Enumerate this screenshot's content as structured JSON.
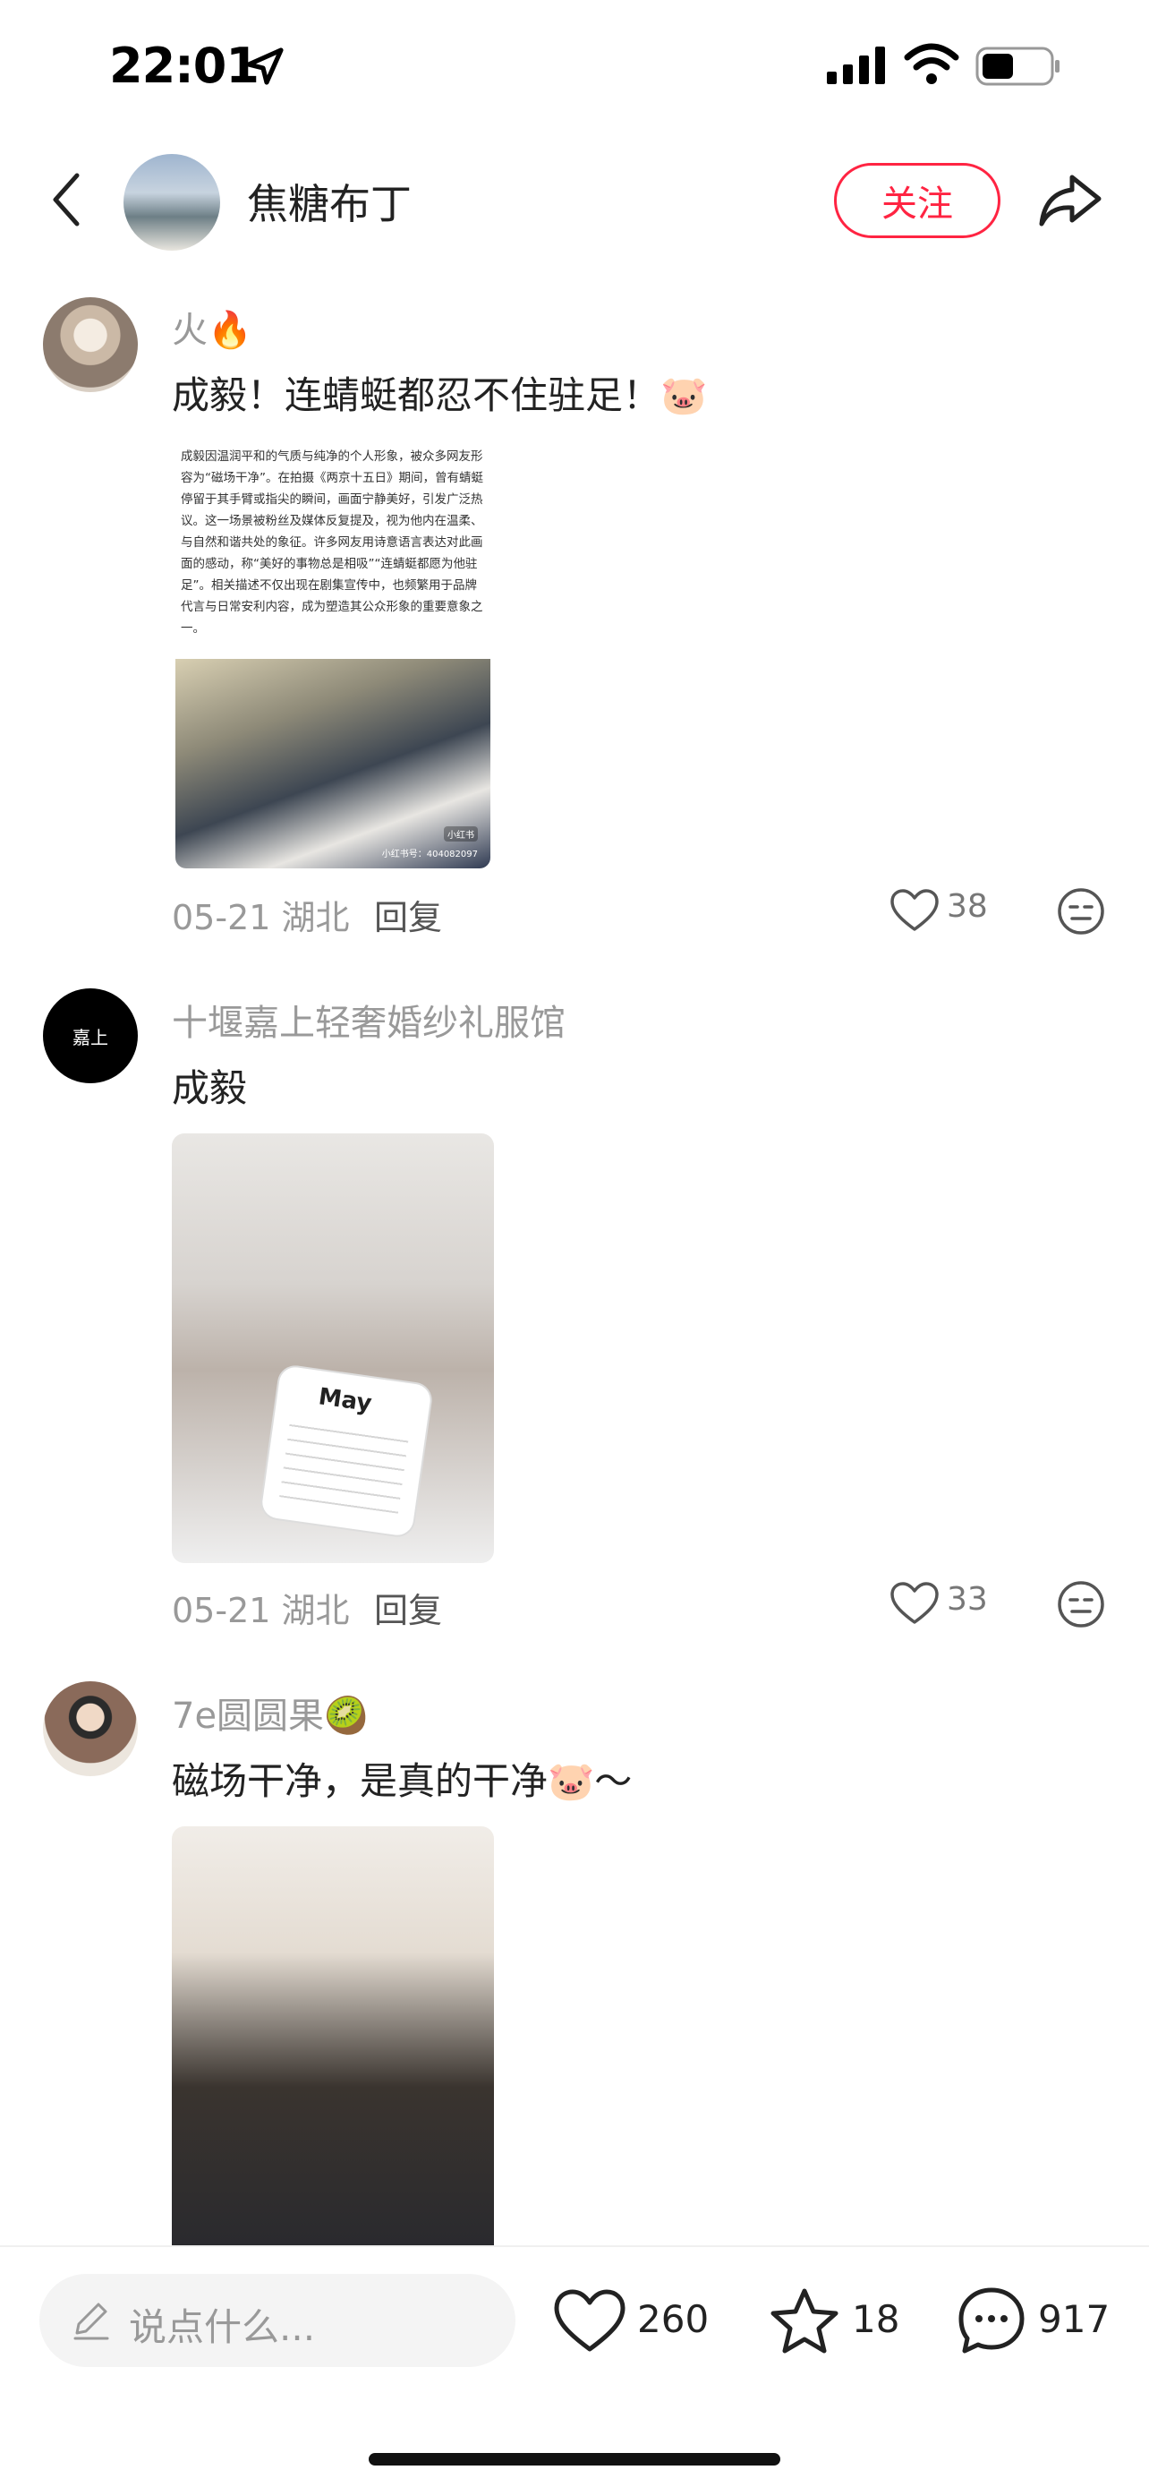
{
  "status_bar": {
    "time": "22:01"
  },
  "nav": {
    "title": "焦糖布丁",
    "follow_label": "关注"
  },
  "comments": [
    {
      "username": "火🔥",
      "text": "成毅！连蜻蜓都忍不住驻足！🐷",
      "image_text": "成毅因温润平和的气质与纯净的个人形象，被众多网友形容为“磁场干净”。在拍摄《两京十五日》期间，曾有蜻蜓停留于其手臂或指尖的瞬间，画面宁静美好，引发广泛热议。这一场景被粉丝及媒体反复提及，视为他内在温柔、与自然和谐共处的象征。许多网友用诗意语言表达对此画面的感动，称“美好的事物总是相吸”“连蜻蜓都愿为他驻足”。相关描述不仅出现在剧集宣传中，也频繁用于品牌代言与日常安利内容，成为塑造其公众形象的重要意象之一。",
      "image_watermark": "小红书号：404082097",
      "image_tag": "小红书",
      "date_location": "05-21 湖北",
      "reply_label": "回复",
      "likes": "38"
    },
    {
      "username": "十堰嘉上轻奢婚纱礼服馆",
      "avatar_text": "嘉上",
      "text": "成毅",
      "image_card_text": "May",
      "date_location": "05-21 湖北",
      "reply_label": "回复",
      "likes": "33"
    },
    {
      "username": "7e圆圆果🥝",
      "text": "磁场干净，是真的干净🐷～"
    }
  ],
  "bottom_bar": {
    "input_placeholder": "说点什么...",
    "likes": "260",
    "stars": "18",
    "comments": "917"
  }
}
